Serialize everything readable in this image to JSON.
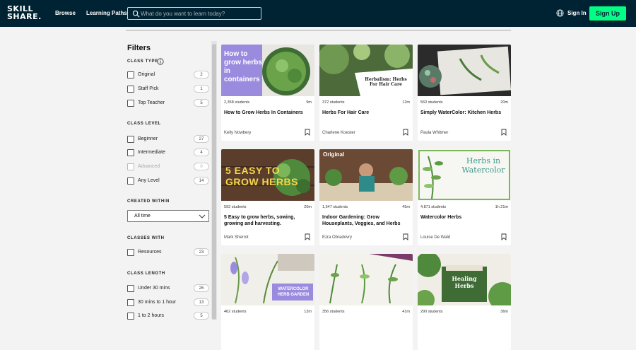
{
  "brand": {
    "logo_line1": "SKILL",
    "logo_line2": "SHARE."
  },
  "nav": {
    "browse": "Browse",
    "learning_paths": "Learning Paths",
    "sign_in": "Sign In",
    "sign_up": "Sign Up"
  },
  "search": {
    "placeholder": "What do you want to learn today?"
  },
  "filters": {
    "title": "Filters",
    "class_type": {
      "title": "CLASS TYPE",
      "options": [
        {
          "label": "Original",
          "count": "2"
        },
        {
          "label": "Staff Pick",
          "count": "1"
        },
        {
          "label": "Top Teacher",
          "count": "5"
        }
      ]
    },
    "class_level": {
      "title": "CLASS LEVEL",
      "options": [
        {
          "label": "Beginner",
          "count": "27"
        },
        {
          "label": "Intermediate",
          "count": "4"
        },
        {
          "label": "Advanced",
          "count": "0"
        },
        {
          "label": "Any Level",
          "count": "14"
        }
      ]
    },
    "created_within": {
      "title": "CREATED WITHIN",
      "selected": "All time"
    },
    "classes_with": {
      "title": "CLASSES WITH",
      "options": [
        {
          "label": "Resources",
          "count": "23"
        }
      ]
    },
    "class_length": {
      "title": "CLASS LENGTH",
      "options": [
        {
          "label": "Under 30 mins",
          "count": "26"
        },
        {
          "label": "30 mins to 1 hour",
          "count": "13"
        },
        {
          "label": "1 to 2 hours",
          "count": "5"
        }
      ]
    }
  },
  "cards": [
    {
      "students": "2,358 students",
      "duration": "9m",
      "title": "How to Grow Herbs In Containers",
      "teacher": "Kelly Nowbery",
      "thumb_text": "How to grow herbs in containers"
    },
    {
      "students": "372 students",
      "duration": "12m",
      "title": "Herbs For Hair Care",
      "teacher": "Charlene Koester",
      "thumb_text": "Herbalism: Herbs For Hair Care"
    },
    {
      "students": "560 students",
      "duration": "20m",
      "title": "Simply WaterColor: Kitchen Herbs",
      "teacher": "Paula Whitmer",
      "thumb_text": ""
    },
    {
      "students": "592 students",
      "duration": "20m",
      "title": "5 Easy to grow herbs, sowing, growing and harvesting.",
      "teacher": "Mark Sherrot",
      "thumb_text": "5 EASY TO GROW HERBS"
    },
    {
      "students": "1,547 students",
      "duration": "45m",
      "title": "Indoor Gardening: Grow Houseplants, Veggies, and Herbs",
      "teacher": "Ezra Obradovry",
      "thumb_text": "Original"
    },
    {
      "students": "4,871 students",
      "duration": "1h 21m",
      "title": "Watercolor Herbs",
      "teacher": "Louise De Wald",
      "thumb_text": "Herbs in Watercolor"
    },
    {
      "students": "462 students",
      "duration": "12m",
      "title": "",
      "teacher": "",
      "thumb_text": "WATERCOLOR HERB GARDEN"
    },
    {
      "students": "356 students",
      "duration": "41m",
      "title": "",
      "teacher": "",
      "thumb_text": ""
    },
    {
      "students": "290 students",
      "duration": "36m",
      "title": "",
      "teacher": "",
      "thumb_text": "Healing Herbs"
    }
  ],
  "colors": {
    "nav_bg": "#002333",
    "accent": "#00ff84",
    "purple": "#9b8bdf"
  }
}
